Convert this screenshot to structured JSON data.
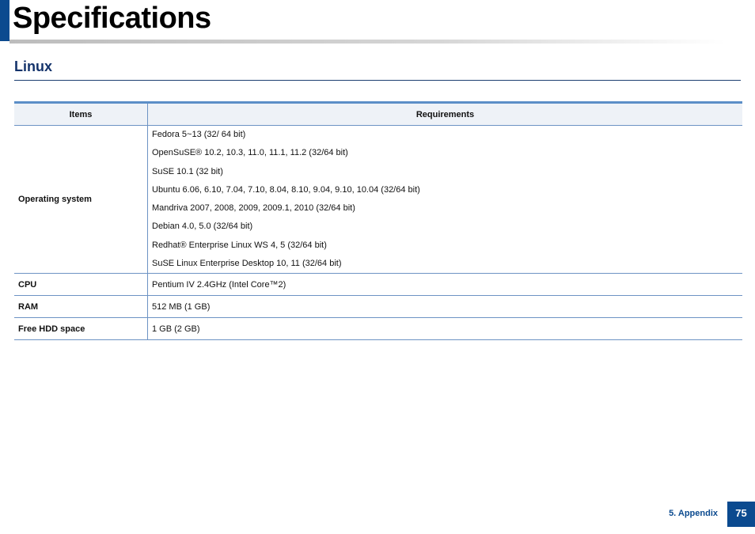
{
  "page": {
    "title": "Specifications",
    "section": "Linux"
  },
  "table": {
    "headers": {
      "items": "Items",
      "requirements": "Requirements"
    },
    "os_label": "Operating system",
    "os_values": [
      "Fedora 5~13 (32/ 64 bit)",
      "OpenSuSE® 10.2, 10.3, 11.0, 11.1, 11.2 (32/64 bit)",
      "SuSE 10.1 (32 bit)",
      "Ubuntu 6.06, 6.10, 7.04, 7.10, 8.04, 8.10, 9.04, 9.10, 10.04 (32/64 bit)",
      "Mandriva 2007, 2008, 2009, 2009.1, 2010 (32/64 bit)",
      "Debian 4.0, 5.0 (32/64 bit)",
      "Redhat® Enterprise Linux WS 4, 5 (32/64 bit)",
      "SuSE Linux Enterprise Desktop 10, 11 (32/64 bit)"
    ],
    "rows": [
      {
        "item": "CPU",
        "value": "Pentium IV 2.4GHz (Intel Core™2)"
      },
      {
        "item": "RAM",
        "value": "512 MB (1 GB)"
      },
      {
        "item": "Free HDD space",
        "value": "1 GB (2 GB)"
      }
    ]
  },
  "footer": {
    "label": "5. Appendix",
    "page_number": "75"
  },
  "colors": {
    "accent": "#0b4a8f",
    "heading": "#14336b",
    "table_border": "#6d93c4",
    "header_fill": "#eef2f7"
  }
}
